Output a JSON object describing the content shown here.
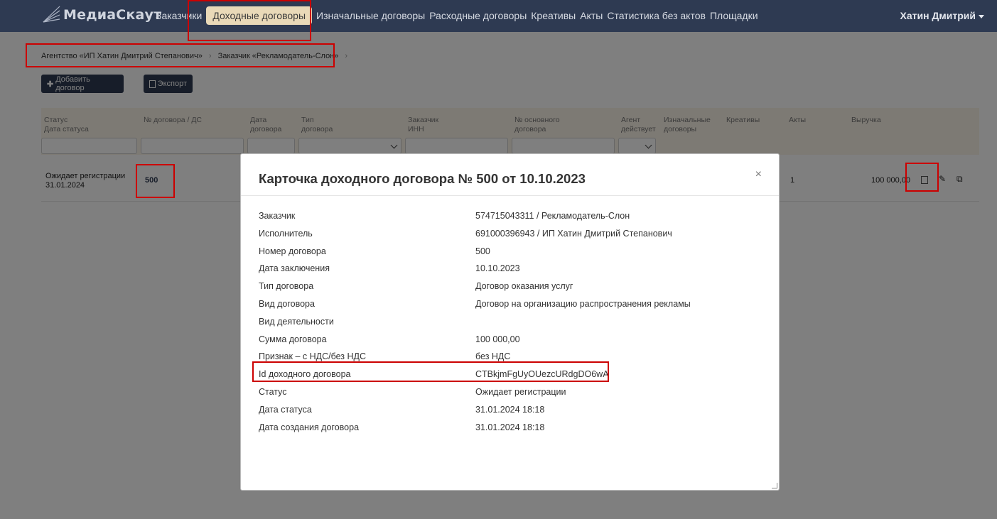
{
  "app": {
    "logo_text": "МедиаСкаут"
  },
  "nav": {
    "items": [
      "Заказчики",
      "Доходные договоры",
      "Изначальные договоры",
      "Расходные договоры",
      "Креативы",
      "Акты",
      "Статистика без актов",
      "Площадки"
    ],
    "active_index": 1,
    "user": "Хатин Дмитрий"
  },
  "breadcrumb": [
    "Агентство «ИП Хатин Дмитрий Степанович»",
    "Заказчик «Рекламодатель-Слон»"
  ],
  "toolbar": {
    "add_label": "Добавить договор",
    "export_label": "Экспорт"
  },
  "table": {
    "columns": [
      [
        "Статус",
        "Дата статуса"
      ],
      [
        "№ договора / ДС"
      ],
      [
        "Дата",
        "договора"
      ],
      [
        "Тип",
        "договора"
      ],
      [
        "Заказчик",
        "ИНН"
      ],
      [
        "№ основного",
        "договора"
      ],
      [
        "Агент",
        "действует"
      ],
      [
        "Изначальные",
        "договоры"
      ],
      [
        "Креативы"
      ],
      [
        "Акты"
      ],
      [
        "Выручка"
      ]
    ],
    "row": {
      "status": "Ожидает регистрации",
      "status_date": "31.01.2024",
      "number": "500",
      "acts": "1",
      "revenue": "100 000,00"
    }
  },
  "modal": {
    "title": "Карточка доходного договора № 500 от 10.10.2023",
    "close": "×",
    "fields": [
      {
        "label": "Заказчик",
        "value": "574715043311 / Рекламодатель-Слон"
      },
      {
        "label": "Исполнитель",
        "value": "691000396943 / ИП Хатин Дмитрий Степанович"
      },
      {
        "label": "Номер договора",
        "value": "500"
      },
      {
        "label": "Дата заключения",
        "value": "10.10.2023"
      },
      {
        "label": "Тип договора",
        "value": "Договор оказания услуг"
      },
      {
        "label": "Вид договора",
        "value": "Договор на организацию распространения рекламы"
      },
      {
        "label": "Вид деятельности",
        "value": ""
      },
      {
        "label": "Сумма договора",
        "value": "100 000,00"
      },
      {
        "label": "Признак – с НДС/без НДС",
        "value": "без НДС"
      },
      {
        "label": "Id доходного договора",
        "value": "CTBkjmFgUyOUezcURdgDO6wA"
      },
      {
        "label": "Статус",
        "value": "Ожидает регистрации"
      },
      {
        "label": "Дата статуса",
        "value": "31.01.2024 18:18"
      },
      {
        "label": "Дата создания договора",
        "value": "31.01.2024 18:18"
      }
    ]
  },
  "colors": {
    "navbar": "#2e3a52",
    "active_tab": "#e9d9b8",
    "table_header": "#fbf4e8",
    "annotation": "#cc0000"
  }
}
